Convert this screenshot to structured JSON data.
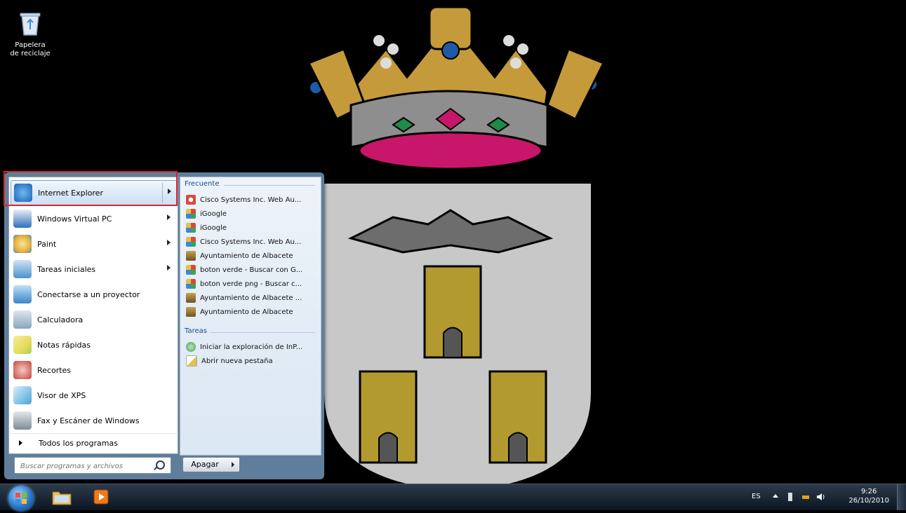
{
  "desktop": {
    "recycle_bin_label": "Papelera de reciclaje"
  },
  "start_menu": {
    "pinned": [
      {
        "label": "Internet Explorer",
        "icon": "internet-explorer-icon",
        "color": "#3d86d6",
        "submenu": true
      },
      {
        "label": "Windows Virtual PC",
        "icon": "virtual-pc-icon",
        "color": "#2f6fbf",
        "submenu": true
      },
      {
        "label": "Paint",
        "icon": "paint-icon",
        "color": "#e9b13a",
        "submenu": true
      },
      {
        "label": "Tareas iniciales",
        "icon": "getting-started-icon",
        "color": "#4b92d0",
        "submenu": true
      },
      {
        "label": "Conectarse a un proyector",
        "icon": "projector-icon",
        "color": "#3b86c6",
        "submenu": false
      },
      {
        "label": "Calculadora",
        "icon": "calculator-icon",
        "color": "#8aa4bd",
        "submenu": false
      },
      {
        "label": "Notas rápidas",
        "icon": "sticky-notes-icon",
        "color": "#e7dc5b",
        "submenu": false
      },
      {
        "label": "Recortes",
        "icon": "snipping-tool-icon",
        "color": "#c9443c",
        "submenu": false
      },
      {
        "label": "Visor de XPS",
        "icon": "xps-viewer-icon",
        "color": "#4aa3d8",
        "submenu": false
      },
      {
        "label": "Fax y Escáner de Windows",
        "icon": "fax-scanner-icon",
        "color": "#7d8a96",
        "submenu": false
      }
    ],
    "all_programs_label": "Todos los programas",
    "search_placeholder": "Buscar programas y archivos",
    "shutdown_label": "Apagar",
    "jumplist": {
      "frequent_header": "Frecuente",
      "frequent": [
        {
          "label": "Cisco Systems Inc. Web Au...",
          "icon": "cisco-icon",
          "color": "#d94a3d"
        },
        {
          "label": "iGoogle",
          "icon": "google-icon",
          "color": "#3aa35a"
        },
        {
          "label": "iGoogle",
          "icon": "google-icon",
          "color": "#3aa35a"
        },
        {
          "label": "Cisco Systems Inc. Web Au...",
          "icon": "google-icon",
          "color": "#3aa35a"
        },
        {
          "label": "Ayuntamiento de Albacete",
          "icon": "albacete-crest-icon",
          "color": "#9a7b3c"
        },
        {
          "label": "boton verde - Buscar con G...",
          "icon": "google-icon",
          "color": "#3aa35a"
        },
        {
          "label": "boton verde png - Buscar c...",
          "icon": "google-icon",
          "color": "#3aa35a"
        },
        {
          "label": "Ayuntamiento de Albacete ...",
          "icon": "albacete-crest-icon",
          "color": "#9a7b3c"
        },
        {
          "label": "Ayuntamiento de Albacete",
          "icon": "albacete-crest-icon",
          "color": "#9a7b3c"
        }
      ],
      "tasks_header": "Tareas",
      "tasks": [
        {
          "label": "Iniciar la exploración de InP...",
          "icon": "inprivate-icon",
          "color": "#4a9a55"
        },
        {
          "label": "Abrir nueva pestaña",
          "icon": "new-tab-icon",
          "color": "#e2c24a"
        }
      ]
    }
  },
  "taskbar": {
    "language": "ES",
    "time": "9:26",
    "date": "26/10/2010"
  }
}
